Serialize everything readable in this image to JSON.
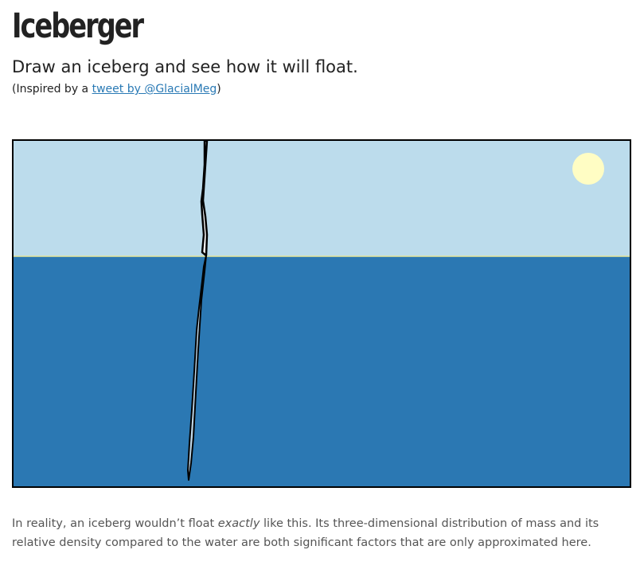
{
  "header": {
    "title": "Iceberger",
    "subtitle": "Draw an iceberg and see how it will float.",
    "credit_prefix": "(Inspired by a ",
    "credit_link": "tweet by @GlacialMeg",
    "credit_suffix": ")"
  },
  "scene": {
    "sky_color": "#bcdcec",
    "water_color": "#2b78b3",
    "waterline_color": "#e8e79a",
    "sun_color": "#fffdc4",
    "ice_color": "#ffffff",
    "ice_outline_color": "#000000"
  },
  "footnote": {
    "part1": "In reality, an iceberg wouldn’t float ",
    "emphasis": "exactly",
    "part2": " like this. Its three-dimensional distribution of mass and its relative density compared to the water are both significant factors that are only approximated here."
  }
}
